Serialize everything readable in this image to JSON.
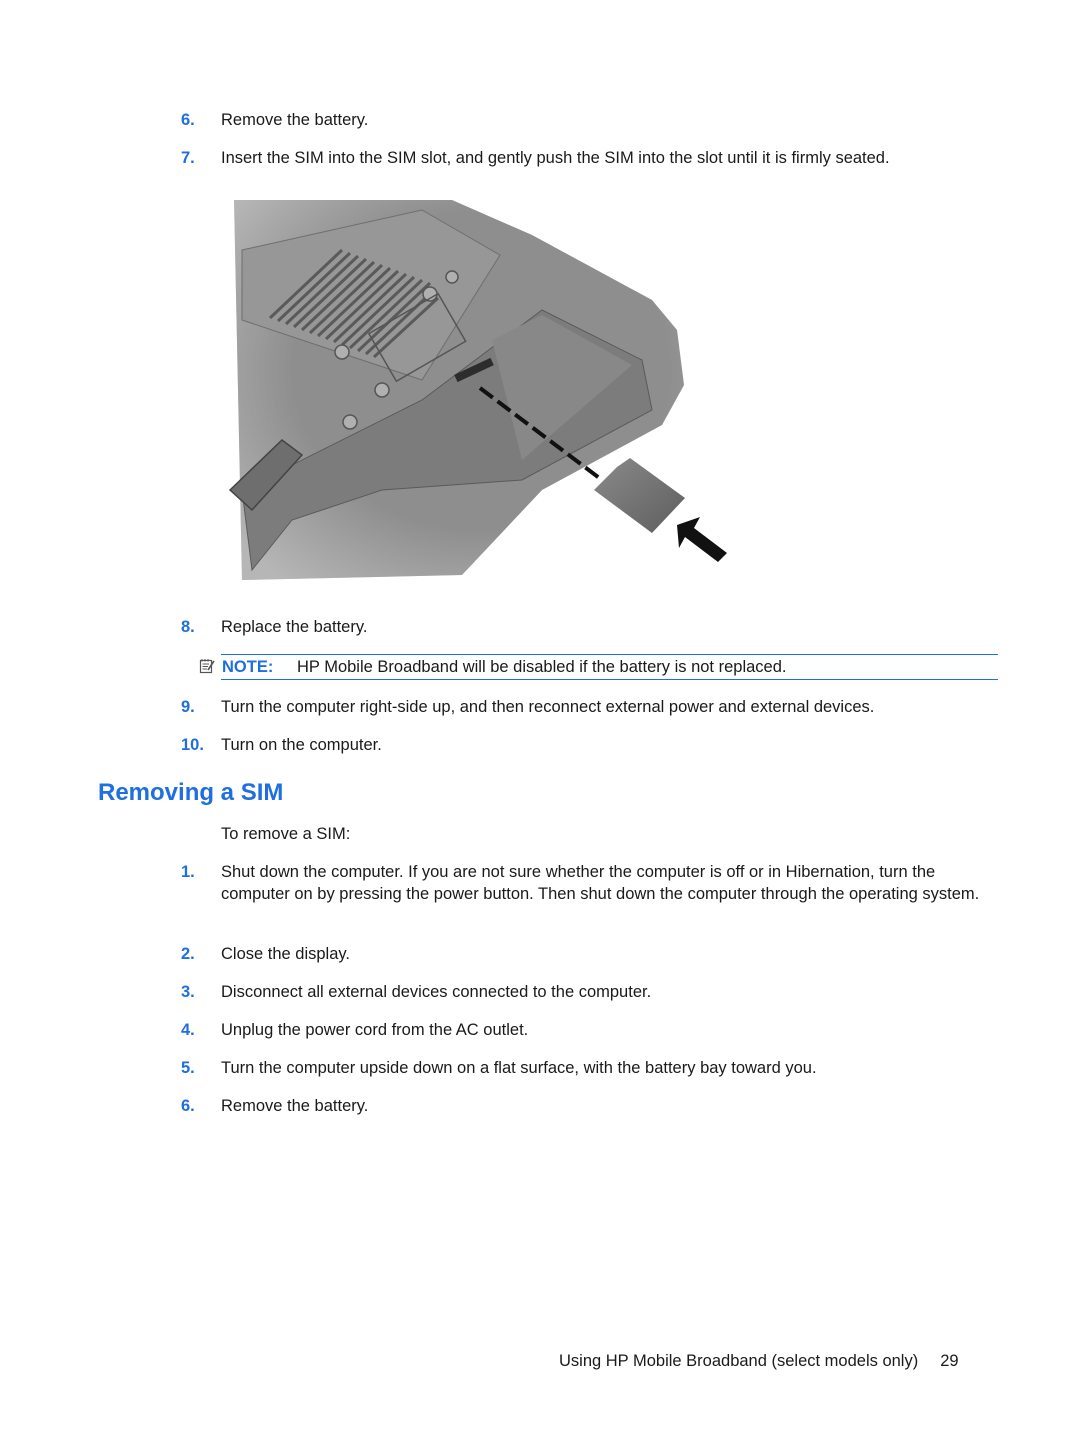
{
  "steps_top": [
    {
      "num": "6.",
      "text": "Remove the battery."
    },
    {
      "num": "7.",
      "text": "Insert the SIM into the SIM slot, and gently push the SIM into the slot until it is firmly seated."
    },
    {
      "num": "8.",
      "text": "Replace the battery."
    }
  ],
  "note": {
    "icon": "note-pad-icon",
    "label": "NOTE:",
    "text": "HP Mobile Broadband will be disabled if the battery is not replaced."
  },
  "steps_after_note": [
    {
      "num": "9.",
      "text": "Turn the computer right-side up, and then reconnect external power and external devices."
    },
    {
      "num": "10.",
      "text": "Turn on the computer."
    }
  ],
  "figure": {
    "description": "Bottom of notebook computer with SIM card being inserted into SIM slot in battery bay, dashed line and arrow indicating insertion direction"
  },
  "section": {
    "title": "Removing a SIM",
    "intro": "To remove a SIM:",
    "steps": [
      {
        "num": "1.",
        "text": "Shut down the computer. If you are not sure whether the computer is off or in Hibernation, turn the computer on by pressing the power button. Then shut down the computer through the operating system."
      },
      {
        "num": "2.",
        "text": "Close the display."
      },
      {
        "num": "3.",
        "text": "Disconnect all external devices connected to the computer."
      },
      {
        "num": "4.",
        "text": "Unplug the power cord from the AC outlet."
      },
      {
        "num": "5.",
        "text": "Turn the computer upside down on a flat surface, with the battery bay toward you."
      },
      {
        "num": "6.",
        "text": "Remove the battery."
      }
    ]
  },
  "footer": {
    "text": "Using HP Mobile Broadband (select models only)",
    "page": "29"
  },
  "colors": {
    "accent": "#1f6fe0",
    "text": "#1a1a1a"
  }
}
